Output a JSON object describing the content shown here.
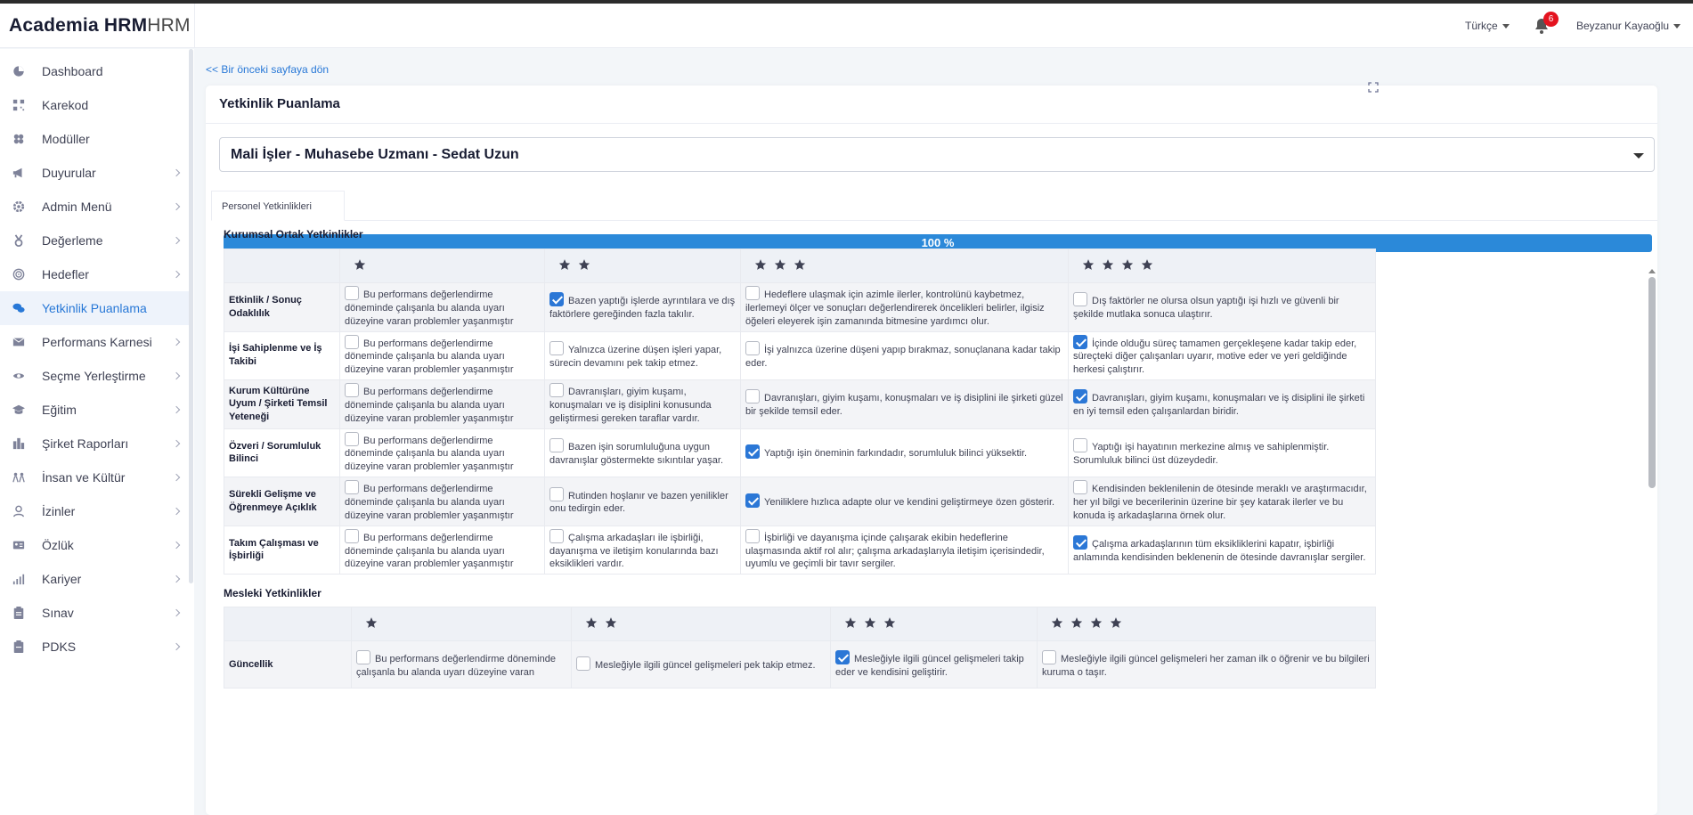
{
  "app": {
    "logo_bold": "Academia HRM",
    "logo_thin": "HRM"
  },
  "header": {
    "language": "Türkçe",
    "notification_count": "6",
    "user_name": "Beyzanur Kayaoğlu"
  },
  "sidebar": {
    "items": [
      {
        "label": "Dashboard",
        "icon": "pie-chart-icon",
        "has_submenu": false,
        "active": false
      },
      {
        "label": "Karekod",
        "icon": "qr-code-icon",
        "has_submenu": false,
        "active": false
      },
      {
        "label": "Modüller",
        "icon": "modules-icon",
        "has_submenu": false,
        "active": false
      },
      {
        "label": "Duyurular",
        "icon": "megaphone-icon",
        "has_submenu": true,
        "active": false
      },
      {
        "label": "Admin Menü",
        "icon": "gear-icon",
        "has_submenu": true,
        "active": false
      },
      {
        "label": "Değerleme",
        "icon": "medal-icon",
        "has_submenu": true,
        "active": false
      },
      {
        "label": "Hedefler",
        "icon": "target-icon",
        "has_submenu": true,
        "active": false
      },
      {
        "label": "Yetkinlik Puanlama",
        "icon": "chat-icon",
        "has_submenu": false,
        "active": true
      },
      {
        "label": "Performans Karnesi",
        "icon": "envelope-icon",
        "has_submenu": true,
        "active": false
      },
      {
        "label": "Seçme Yerleştirme",
        "icon": "eye-icon",
        "has_submenu": true,
        "active": false
      },
      {
        "label": "Eğitim",
        "icon": "graduation-cap-icon",
        "has_submenu": true,
        "active": false
      },
      {
        "label": "Şirket Raporları",
        "icon": "city-icon",
        "has_submenu": true,
        "active": false
      },
      {
        "label": "İnsan ve Kültür",
        "icon": "people-icon",
        "has_submenu": true,
        "active": false
      },
      {
        "label": "İzinler",
        "icon": "user-icon",
        "has_submenu": true,
        "active": false
      },
      {
        "label": "Özlük",
        "icon": "id-card-icon",
        "has_submenu": true,
        "active": false
      },
      {
        "label": "Kariyer",
        "icon": "signal-bars-icon",
        "has_submenu": true,
        "active": false
      },
      {
        "label": "Sınav",
        "icon": "clipboard-icon",
        "has_submenu": true,
        "active": false
      },
      {
        "label": "PDKS",
        "icon": "badge-icon",
        "has_submenu": true,
        "active": false
      }
    ]
  },
  "page": {
    "back_link": "<< Bir önceki sayfaya dön",
    "card_title": "Yetkinlik Puanlama",
    "selected_person": "Mali İşler - Muhasebe Uzmanı - Sedat Uzun",
    "tab_label": "Personel Yetkinlikleri",
    "progress_text": "100 %",
    "progress_value": 100
  },
  "sections": [
    {
      "title": "Kurumsal Ortak Yetkinlikler",
      "rows": [
        {
          "name": "Etkinlik / Sonuç Odaklılık",
          "cells": [
            {
              "text": "Bu performans değerlendirme döneminde çalışanla bu alanda uyarı düzeyine varan problemler yaşanmıştır",
              "checked": false
            },
            {
              "text": "Bazen yaptığı işlerde ayrıntılara ve dış faktörlere gereğinden fazla takılır.",
              "checked": true
            },
            {
              "text": "Hedeflere ulaşmak için azimle ilerler, kontrolünü kaybetmez, ilerlemeyi ölçer ve sonuçları değerlendirerek öncelikleri belirler, ilgisiz öğeleri eleyerek işin zamanında bitmesine yardımcı olur.",
              "checked": false
            },
            {
              "text": "Dış faktörler ne olursa olsun yaptığı işi hızlı ve güvenli bir şekilde mutlaka sonuca ulaştırır.",
              "checked": false
            }
          ]
        },
        {
          "name": "İşi Sahiplenme ve İş Takibi",
          "cells": [
            {
              "text": "Bu performans değerlendirme döneminde çalışanla bu alanda uyarı düzeyine varan problemler yaşanmıştır",
              "checked": false
            },
            {
              "text": "Yalnızca üzerine düşen işleri yapar, sürecin devamını pek takip etmez.",
              "checked": false
            },
            {
              "text": "İşi yalnızca üzerine düşeni yapıp bırakmaz, sonuçlanana kadar takip eder.",
              "checked": false
            },
            {
              "text": "İçinde olduğu süreç tamamen gerçekleşene kadar takip eder, süreçteki diğer çalışanları uyarır, motive eder ve yeri geldiğinde herkesi çalıştırır.",
              "checked": true
            }
          ]
        },
        {
          "name": "Kurum Kültürüne Uyum / Şirketi Temsil Yeteneği",
          "cells": [
            {
              "text": "Bu performans değerlendirme döneminde çalışanla bu alanda uyarı düzeyine varan problemler yaşanmıştır",
              "checked": false
            },
            {
              "text": "Davranışları, giyim kuşamı, konuşmaları ve iş disiplini konusunda geliştirmesi gereken taraflar vardır.",
              "checked": false
            },
            {
              "text": "Davranışları, giyim kuşamı, konuşmaları ve iş disiplini ile şirketi güzel bir şekilde temsil eder.",
              "checked": false
            },
            {
              "text": "Davranışları, giyim kuşamı, konuşmaları ve iş disiplini ile şirketi en iyi temsil eden çalışanlardan biridir.",
              "checked": true
            }
          ]
        },
        {
          "name": "Özveri / Sorumluluk Bilinci",
          "cells": [
            {
              "text": "Bu performans değerlendirme döneminde çalışanla bu alanda uyarı düzeyine varan problemler yaşanmıştır",
              "checked": false
            },
            {
              "text": "Bazen işin sorumluluğuna uygun davranışlar göstermekte sıkıntılar yaşar.",
              "checked": false
            },
            {
              "text": "Yaptığı işin öneminin farkındadır, sorumluluk bilinci yüksektir.",
              "checked": true
            },
            {
              "text": "Yaptığı işi hayatının merkezine almış ve sahiplenmiştir. Sorumluluk bilinci üst düzeydedir.",
              "checked": false
            }
          ]
        },
        {
          "name": "Sürekli Gelişme ve Öğrenmeye Açıklık",
          "cells": [
            {
              "text": "Bu performans değerlendirme döneminde çalışanla bu alanda uyarı düzeyine varan problemler yaşanmıştır",
              "checked": false
            },
            {
              "text": "Rutinden hoşlanır ve bazen yenilikler onu tedirgin eder.",
              "checked": false
            },
            {
              "text": "Yeniliklere hızlıca adapte olur ve kendini geliştirmeye özen gösterir.",
              "checked": true
            },
            {
              "text": "Kendisinden beklenilenin de ötesinde meraklı ve araştırmacıdır, her yıl bilgi ve becerilerinin üzerine bir şey katarak ilerler ve bu konuda iş arkadaşlarına örnek olur.",
              "checked": false
            }
          ]
        },
        {
          "name": "Takım Çalışması ve İşbirliği",
          "cells": [
            {
              "text": "Bu performans değerlendirme döneminde çalışanla bu alanda uyarı düzeyine varan problemler yaşanmıştır",
              "checked": false
            },
            {
              "text": "Çalışma arkadaşları ile işbirliği, dayanışma ve iletişim konularında bazı eksiklikleri vardır.",
              "checked": false
            },
            {
              "text": "İşbirliği ve dayanışma içinde çalışarak ekibin hedeflerine ulaşmasında aktif rol alır; çalışma arkadaşlarıyla iletişim içerisindedir, uyumlu ve geçimli bir tavır sergiler.",
              "checked": false
            },
            {
              "text": "Çalışma arkadaşlarının tüm eksikliklerini kapatır, işbirliği anlamında kendisinden beklenenin de ötesinde davranışlar sergiler.",
              "checked": true
            }
          ]
        }
      ]
    },
    {
      "title": "Mesleki Yetkinlikler",
      "rows": [
        {
          "name": "Güncellik",
          "cells": [
            {
              "text": "Bu performans değerlendirme döneminde çalışanla bu alanda uyarı düzeyine varan",
              "checked": false
            },
            {
              "text": "Mesleğiyle ilgili güncel gelişmeleri pek takip etmez.",
              "checked": false
            },
            {
              "text": "Mesleğiyle ilgili güncel gelişmeleri takip eder ve kendisini geliştirir.",
              "checked": true
            },
            {
              "text": "Mesleğiyle ilgili güncel gelişmeleri her zaman ilk o öğrenir ve bu bilgileri kuruma o taşır.",
              "checked": false
            }
          ]
        }
      ]
    }
  ],
  "star_levels": [
    1,
    2,
    3,
    4
  ]
}
